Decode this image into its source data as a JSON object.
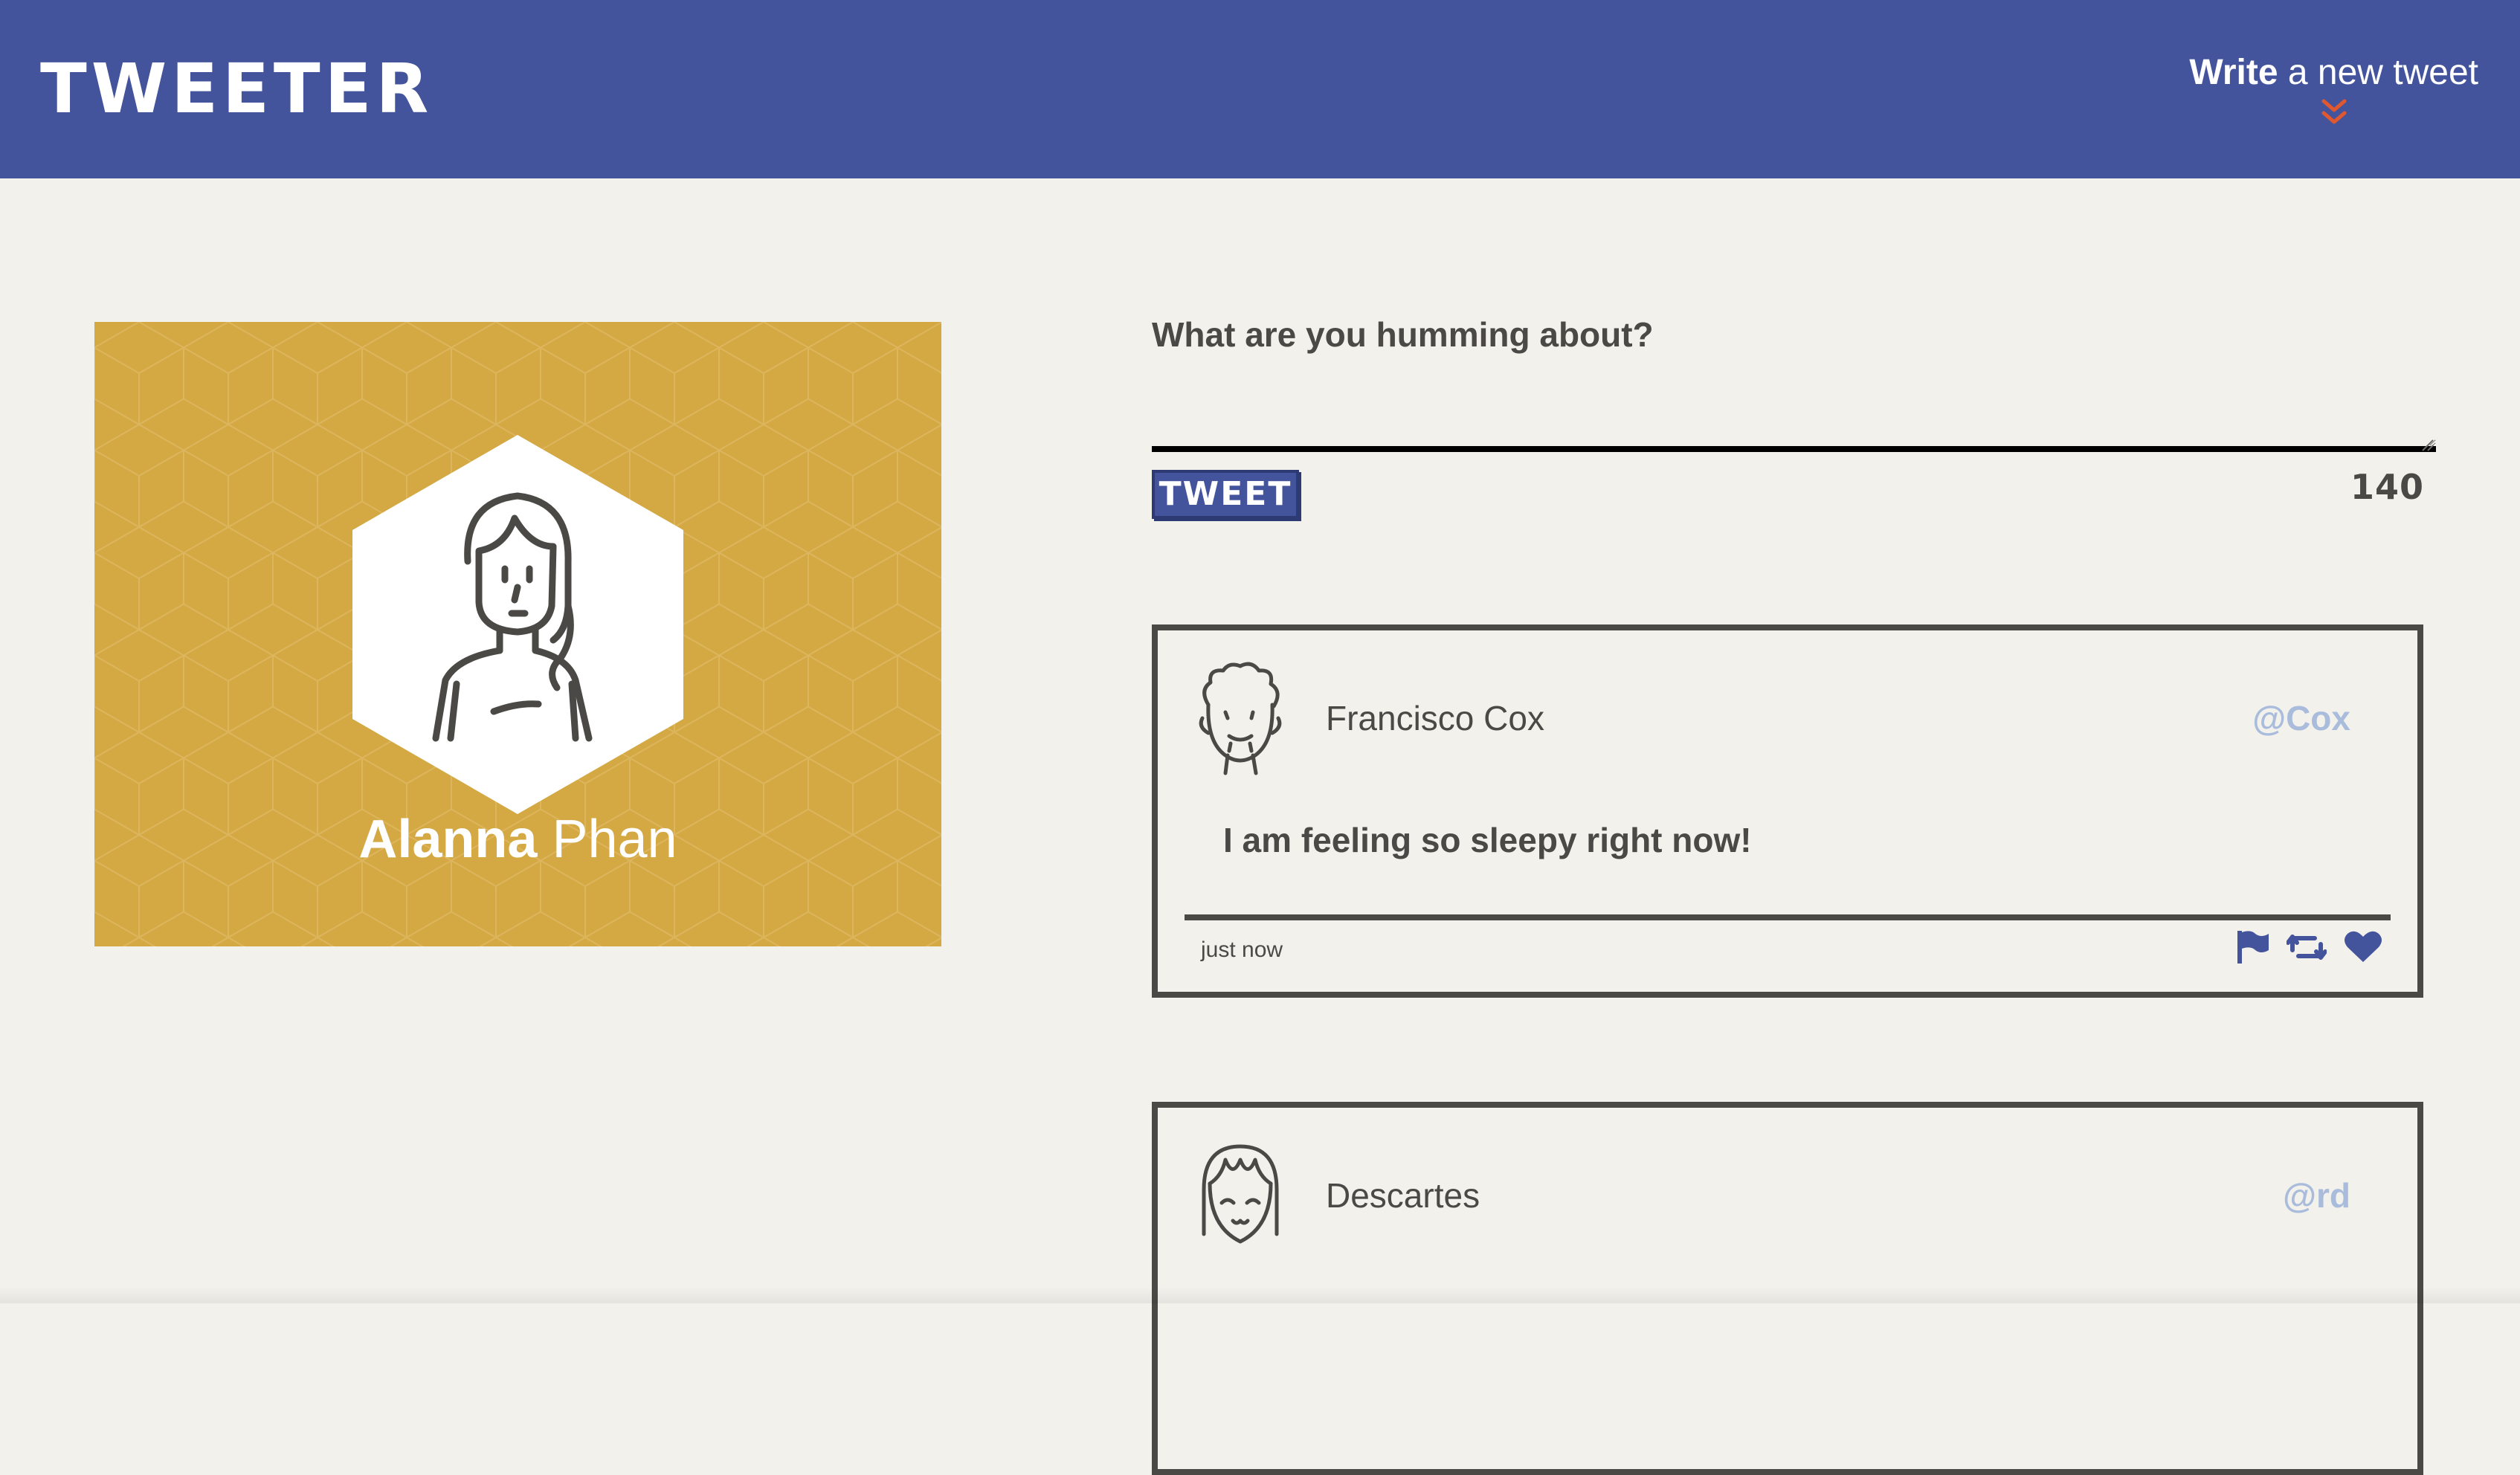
{
  "nav": {
    "brand": "TWEETER",
    "compose_strong": "Write",
    "compose_rest": " a new tweet",
    "compose_icon": "double-chevron-down-icon",
    "accent": "#e0582f"
  },
  "profile": {
    "first_name": "Alanna",
    "last_name": " Phan",
    "background_color": "#d4a843"
  },
  "composer": {
    "prompt": "What are you humming about?",
    "textarea_value": "",
    "button_label": "TWEET",
    "counter": "140"
  },
  "tweets": [
    {
      "author": "Francisco Cox",
      "handle": "@Cox",
      "content": "I am feeling so sleepy right now!",
      "timestamp": "just now",
      "actions": [
        "flag-icon",
        "retweet-icon",
        "heart-icon"
      ]
    },
    {
      "author": "Descartes",
      "handle": "@rd",
      "content": "",
      "timestamp": "",
      "actions": []
    }
  ],
  "colors": {
    "nav_bg": "#44549c",
    "page_bg": "#f3f1ec",
    "text": "#4a4946",
    "handle": "#a9bcdc",
    "icon": "#44549c"
  }
}
